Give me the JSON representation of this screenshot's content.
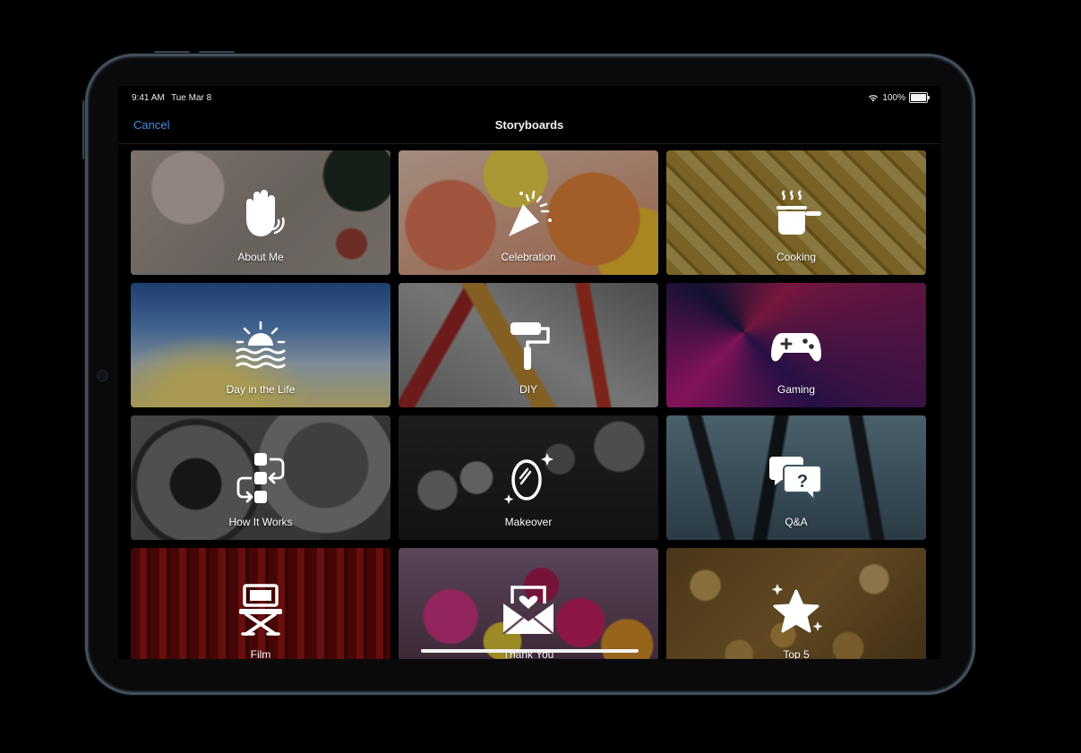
{
  "status": {
    "time": "9:41 AM",
    "date": "Tue Mar 8",
    "battery": "100%"
  },
  "nav": {
    "cancel": "Cancel",
    "title": "Storyboards"
  },
  "tiles": [
    {
      "label": "About Me",
      "icon": "hand-wave-icon"
    },
    {
      "label": "Celebration",
      "icon": "party-popper-icon"
    },
    {
      "label": "Cooking",
      "icon": "cooking-pot-icon"
    },
    {
      "label": "Day in the Life",
      "icon": "sunrise-icon"
    },
    {
      "label": "DIY",
      "icon": "paint-roller-icon"
    },
    {
      "label": "Gaming",
      "icon": "game-controller-icon"
    },
    {
      "label": "How It Works",
      "icon": "flowchart-icon"
    },
    {
      "label": "Makeover",
      "icon": "mirror-sparkle-icon"
    },
    {
      "label": "Q&A",
      "icon": "question-bubbles-icon"
    },
    {
      "label": "Film",
      "icon": "director-chair-icon"
    },
    {
      "label": "Thank You",
      "icon": "heart-envelope-icon"
    },
    {
      "label": "Top 5",
      "icon": "star-sparkle-icon"
    }
  ]
}
